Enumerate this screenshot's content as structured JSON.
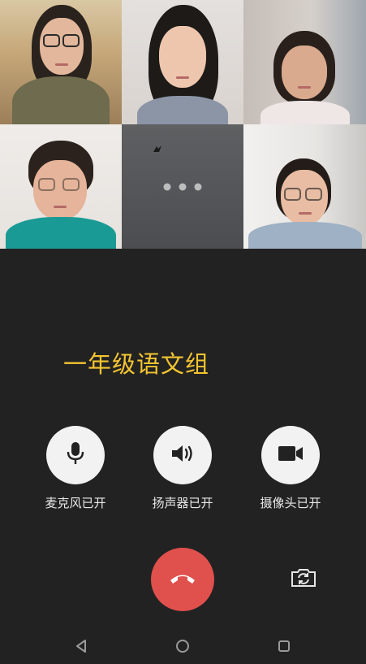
{
  "group_title": "一年级语文组",
  "participants": [
    {
      "name": "participant-1",
      "status": "video"
    },
    {
      "name": "participant-2",
      "status": "video"
    },
    {
      "name": "participant-3",
      "status": "video"
    },
    {
      "name": "participant-4",
      "status": "video"
    },
    {
      "name": "participant-5",
      "status": "connecting"
    },
    {
      "name": "participant-6",
      "status": "video"
    }
  ],
  "controls": {
    "mic_label": "麦克风已开",
    "speaker_label": "扬声器已开",
    "camera_label": "摄像头已开"
  },
  "icons": {
    "mic": "microphone-icon",
    "speaker": "speaker-icon",
    "camera": "video-camera-icon",
    "hangup": "phone-hangup-icon",
    "switch_camera": "switch-camera-icon",
    "nav_back": "back-triangle-icon",
    "nav_home": "home-circle-icon",
    "nav_recent": "recent-square-icon"
  },
  "colors": {
    "background": "#222222",
    "title": "#f4c531",
    "hangup": "#e0504d",
    "control_circle": "#f2f2f2"
  }
}
